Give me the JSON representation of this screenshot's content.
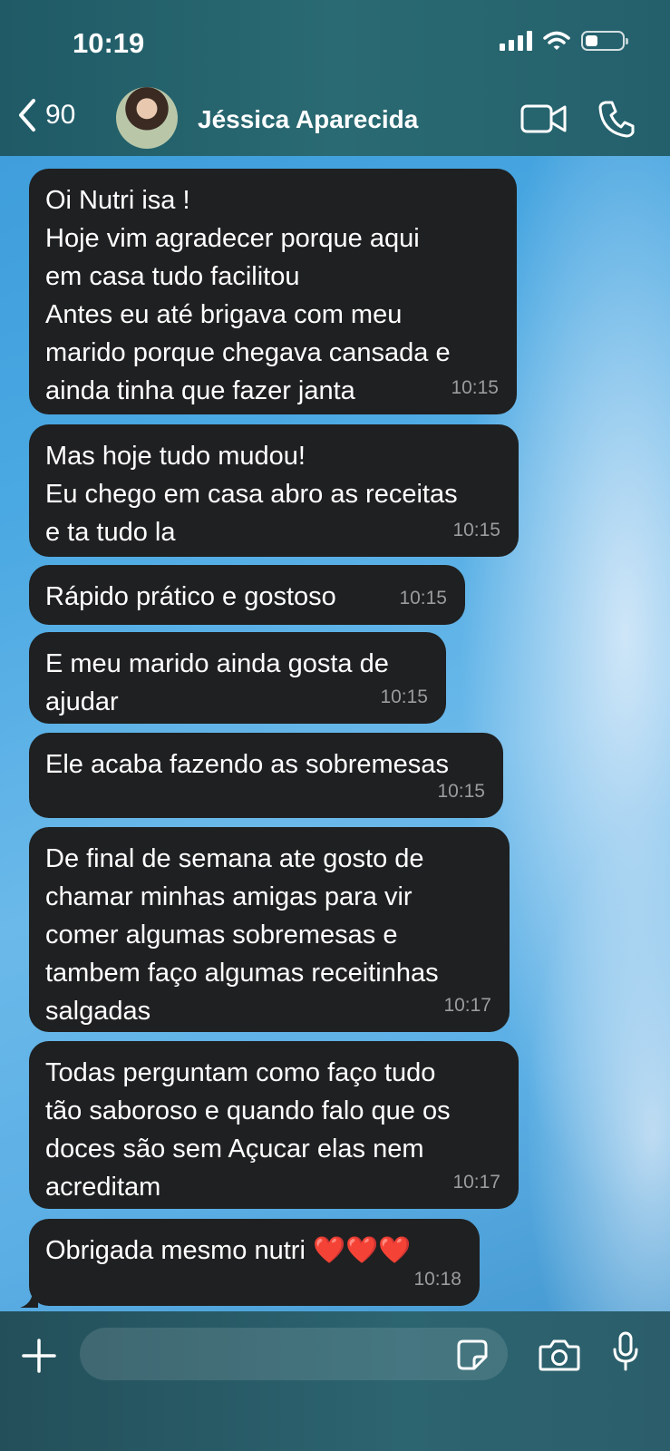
{
  "status_bar": {
    "time": "10:19",
    "battery_level": 0.35
  },
  "header": {
    "back_count": "90",
    "contact_name": "Jéssica Aparecida",
    "icons": [
      "chevron-left-icon",
      "video-call-icon",
      "phone-icon"
    ]
  },
  "messages": [
    {
      "text": "Oi Nutri isa !\nHoje vim agradecer porque aqui\nem casa tudo facilitou\nAntes eu até brigava com meu\nmarido porque chegava cansada e\nainda tinha que fazer janta",
      "time": "10:15"
    },
    {
      "text": "Mas hoje tudo mudou!\nEu chego em casa abro as receitas\ne ta tudo la",
      "time": "10:15"
    },
    {
      "text": "Rápido prático e gostoso",
      "time": "10:15"
    },
    {
      "text": "E meu marido ainda gosta de\najudar",
      "time": "10:15"
    },
    {
      "text": "Ele acaba fazendo as sobremesas",
      "time": "10:15"
    },
    {
      "text": "De final de semana ate gosto de\nchamar minhas amigas para vir\ncomer algumas sobremesas e\ntambem faço algumas receitinhas\nsalgadas",
      "time": "10:17"
    },
    {
      "text": "Todas perguntam como faço tudo\ntão saboroso e quando falo que os\ndoces são sem Açucar elas nem\nacreditam",
      "time": "10:17"
    },
    {
      "text": "Obrigada mesmo nutri ❤️❤️❤️",
      "time": "10:18"
    }
  ],
  "composer": {
    "placeholder": "",
    "icons": [
      "plus-icon",
      "sticker-icon",
      "camera-icon",
      "microphone-icon"
    ]
  },
  "colors": {
    "header_bg": "#245f6a",
    "bubble_bg": "#1f2021",
    "timestamp": "#9a9c9e",
    "wallpaper": "#4aa8e2"
  }
}
